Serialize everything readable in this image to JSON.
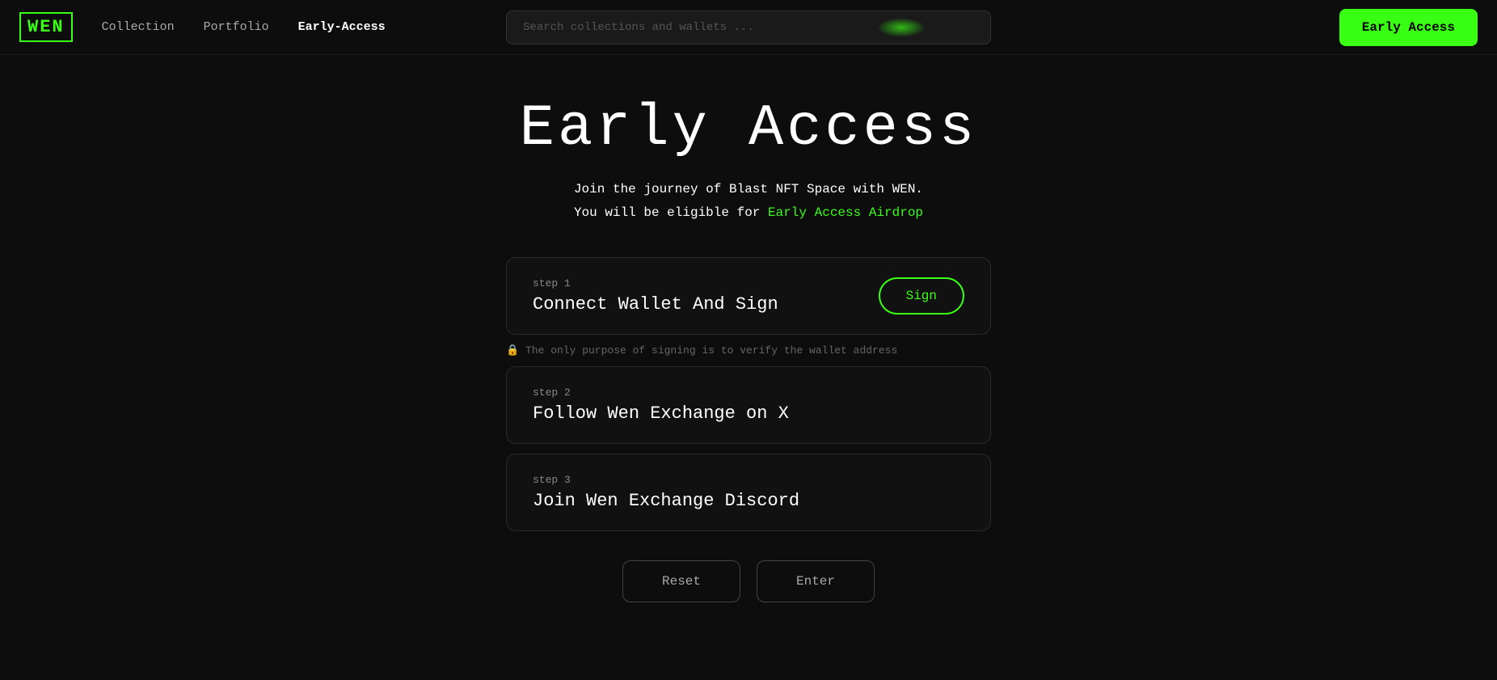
{
  "navbar": {
    "logo": "WEN",
    "nav_items": [
      {
        "label": "Collection",
        "active": false
      },
      {
        "label": "Portfolio",
        "active": false
      },
      {
        "label": "Early-Access",
        "active": true
      }
    ],
    "search_placeholder": "Search collections and wallets ...",
    "early_access_button": "Early Access"
  },
  "hero": {
    "title": "Early Access",
    "subtitle_line1": "Join the journey of Blast NFT Space with WEN.",
    "subtitle_line2_prefix": "You will be eligible for ",
    "subtitle_line2_highlight": "Early Access Airdrop"
  },
  "steps": [
    {
      "step_label": "step 1",
      "step_title": "Connect Wallet And Sign",
      "has_button": true,
      "button_label": "Sign",
      "note": "🔒  The only purpose of signing is to verify the wallet address"
    },
    {
      "step_label": "step 2",
      "step_title": "Follow Wen Exchange on X",
      "has_button": false,
      "button_label": "",
      "note": ""
    },
    {
      "step_label": "step 3",
      "step_title": "Join Wen Exchange Discord",
      "has_button": false,
      "button_label": "",
      "note": ""
    }
  ],
  "actions": {
    "reset_label": "Reset",
    "enter_label": "Enter"
  },
  "colors": {
    "green": "#39ff14",
    "background": "#0d0d0d",
    "card_bg": "#111111"
  }
}
